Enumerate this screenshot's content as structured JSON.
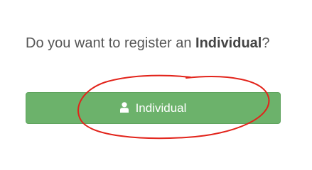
{
  "prompt": {
    "prefix": "Do you want to register an ",
    "emphasis": "Individual",
    "suffix": "?"
  },
  "register_button": {
    "label": "Individual",
    "icon": "user-icon",
    "color": "#6cb26b"
  },
  "annotation": {
    "shape": "hand-drawn ellipse",
    "color": "#e2231a"
  }
}
